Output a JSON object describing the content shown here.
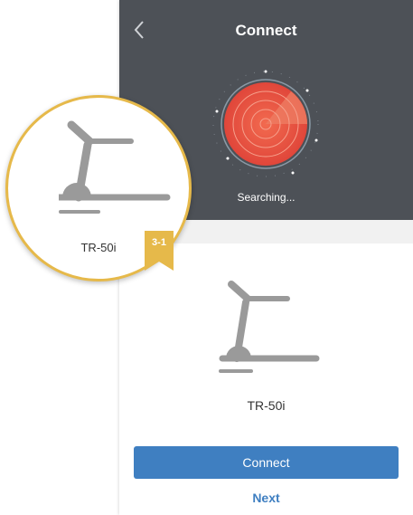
{
  "header": {
    "title": "Connect",
    "status": "Searching..."
  },
  "device": {
    "name": "TR-50i"
  },
  "callout": {
    "device_name": "TR-50i",
    "step_badge": "3-1"
  },
  "actions": {
    "connect_label": "Connect",
    "next_label": "Next"
  },
  "colors": {
    "header_bg": "#4d5157",
    "accent": "#3f7fc1",
    "radar": "#e5533d",
    "callout_border": "#e6b94a",
    "icon_gray": "#9a9a9a"
  },
  "icons": {
    "back": "chevron-left-icon",
    "device": "treadmill-icon",
    "radar": "radar-icon"
  }
}
